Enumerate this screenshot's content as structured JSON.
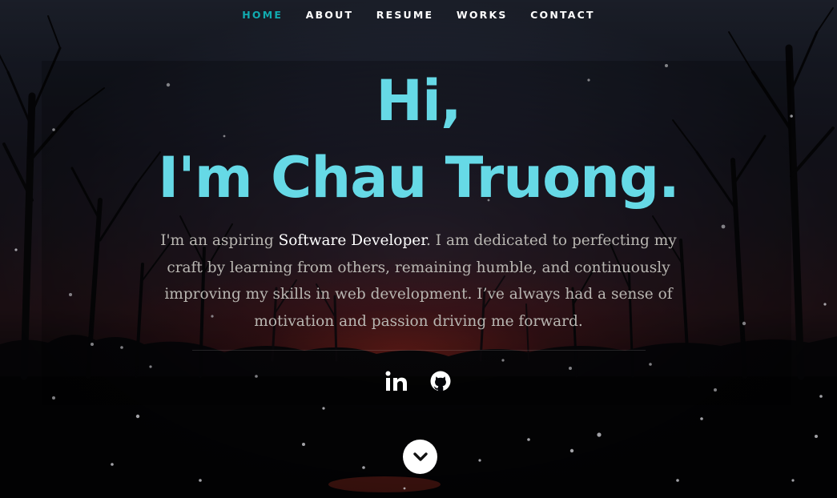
{
  "nav": {
    "items": [
      {
        "label": "HOME",
        "active": true
      },
      {
        "label": "ABOUT",
        "active": false
      },
      {
        "label": "RESUME",
        "active": false
      },
      {
        "label": "WORKS",
        "active": false
      },
      {
        "label": "CONTACT",
        "active": false
      }
    ]
  },
  "hero": {
    "headline_line1": "Hi,",
    "headline_line2": "I'm Chau Truong.",
    "bio_before": "I'm an aspiring ",
    "bio_highlight": "Software Developer",
    "bio_after": ". I am dedicated to perfecting my craft by learning from others, remaining humble, and continuously improving my skills in web development. I’ve always had a sense of motivation and passion driving me forward."
  },
  "social": {
    "items": [
      {
        "icon": "linkedin-icon"
      },
      {
        "icon": "github-icon"
      }
    ]
  },
  "scroll": {
    "icon": "chevron-down-icon"
  },
  "colors": {
    "accent": "#11abb0",
    "headline": "#66d9e6",
    "bio_text": "#b9b7b2",
    "nav_text": "#ffffff"
  }
}
